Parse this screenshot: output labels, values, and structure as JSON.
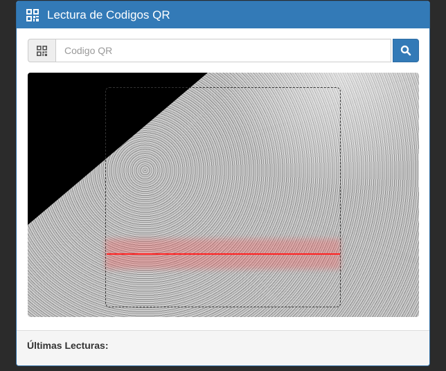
{
  "header": {
    "title": "Lectura de Codigos QR",
    "icon": "qrcode-icon"
  },
  "search": {
    "placeholder": "Codigo QR",
    "value": "",
    "addon_icon": "qrcode-icon",
    "button_icon": "search-icon"
  },
  "footer": {
    "label": "Últimas Lecturas:"
  },
  "colors": {
    "primary": "#337ab7",
    "laser": "#ff2020"
  }
}
